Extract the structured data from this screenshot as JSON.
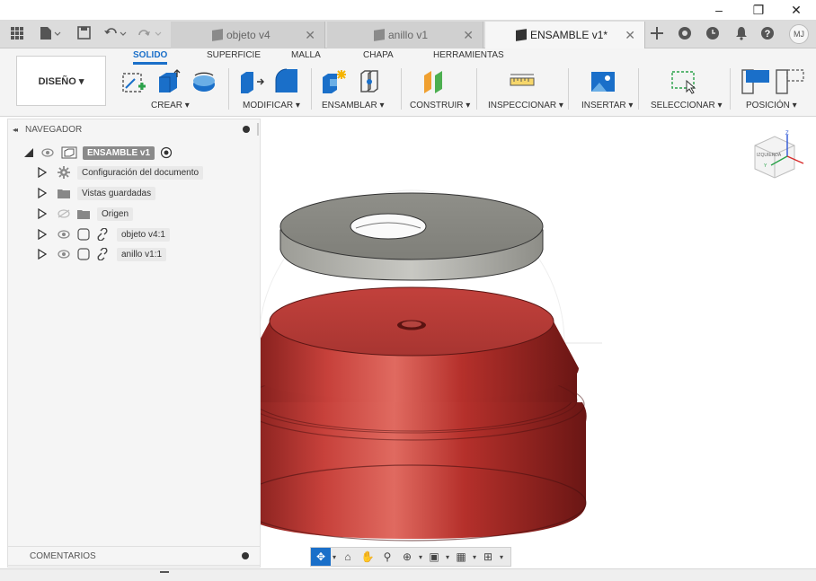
{
  "window": {
    "minimize_glyph": "–",
    "restore_glyph": "❐",
    "close_glyph": "✕"
  },
  "tabs": [
    {
      "label": "objeto v4",
      "active": false
    },
    {
      "label": "anillo v1",
      "active": false
    },
    {
      "label": "ENSAMBLE v1*",
      "active": true
    }
  ],
  "header_icons": [
    "grid-icon",
    "file-icon",
    "save-icon",
    "undo-icon",
    "redo-icon",
    "add-tab-icon",
    "job-status-icon",
    "clock-icon",
    "bell-icon",
    "help-icon"
  ],
  "user_initials": "MJ",
  "design_button": "DISEÑO ▾",
  "workspace_tabs": [
    "SOLIDO",
    "SUPERFICIE",
    "MALLA",
    "CHAPA",
    "HERRAMIENTAS"
  ],
  "active_workspace_tab": "SOLIDO",
  "tool_groups": [
    "CREAR ▾",
    "MODIFICAR ▾",
    "ENSAMBLAR ▾",
    "CONSTRUIR ▾",
    "INSPECCIONAR ▾",
    "INSERTAR ▾",
    "SELECCIONAR ▾",
    "POSICIÓN ▾"
  ],
  "navigator": {
    "title": "NAVEGADOR",
    "collapse_glyph": "◂◂",
    "root": "ENSAMBLE v1",
    "items": [
      {
        "label": "Configuración del documento",
        "icon": "gear-icon"
      },
      {
        "label": "Vistas guardadas",
        "icon": "folder-icon"
      },
      {
        "label": "Origen",
        "icon": "folder-icon"
      },
      {
        "label": "objeto v4:1",
        "icon": "component-link-icon"
      },
      {
        "label": "anillo v1:1",
        "icon": "component-link-icon"
      }
    ]
  },
  "viewcube_label": "IZQUIERDA",
  "comments_label": "COMENTARIOS",
  "colors": {
    "accent": "#1a6fc9",
    "part_red": "#b8302c",
    "ring_gray": "#8c8c86"
  }
}
